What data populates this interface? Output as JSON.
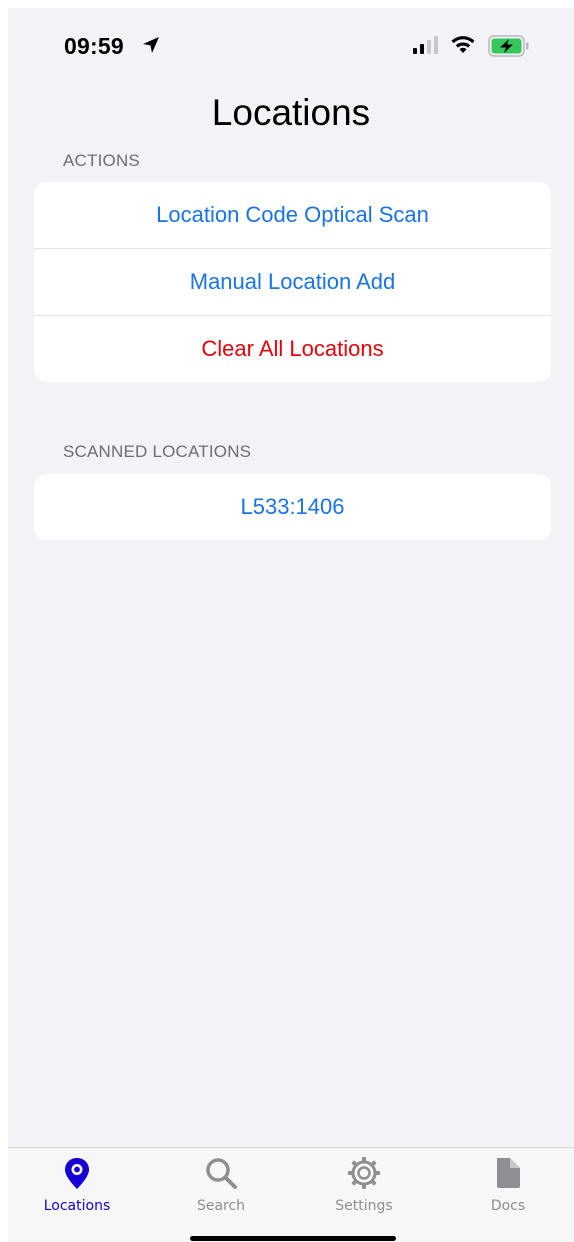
{
  "status_bar": {
    "time": "09:59",
    "location_icon": "location-arrow-icon",
    "signal_icon": "cellular-signal-icon",
    "wifi_icon": "wifi-icon",
    "battery_icon": "battery-charging-icon",
    "battery_color": "#34c759"
  },
  "header": {
    "title": "Locations"
  },
  "actions_section": {
    "header": "ACTIONS",
    "items": [
      {
        "label": "Location Code Optical Scan",
        "style": "default"
      },
      {
        "label": "Manual Location Add",
        "style": "default"
      },
      {
        "label": "Clear All Locations",
        "style": "destructive"
      }
    ]
  },
  "scanned_section": {
    "header": "SCANNED LOCATIONS",
    "items": [
      {
        "label": "L533:1406"
      }
    ]
  },
  "tab_bar": {
    "tabs": [
      {
        "label": "Locations",
        "icon": "map-pin-icon",
        "active": true
      },
      {
        "label": "Search",
        "icon": "magnifying-glass-icon",
        "active": false
      },
      {
        "label": "Settings",
        "icon": "gear-icon",
        "active": false
      },
      {
        "label": "Docs",
        "icon": "document-icon",
        "active": false
      }
    ]
  },
  "colors": {
    "accent": "#1a73e8",
    "destructive": "#e8000b",
    "active_tab": "#1400d6",
    "inactive_tab": "#8e8e93",
    "background": "#f2f2f7"
  }
}
